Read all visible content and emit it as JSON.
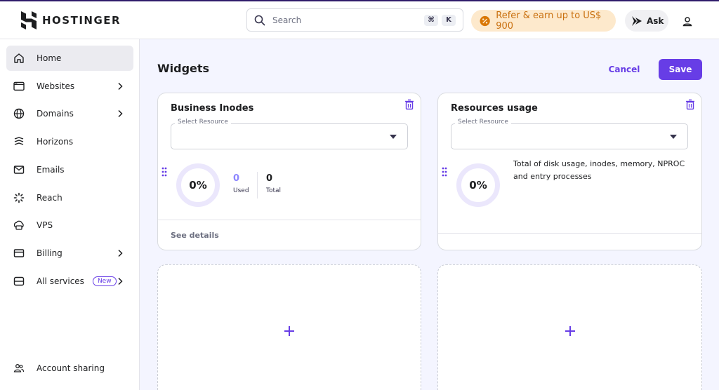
{
  "header": {
    "logo_text": "HOSTINGER",
    "search_placeholder": "Search",
    "search_kbd": [
      "⌘",
      "K"
    ],
    "refer_label": "Refer & earn up to US$ 900",
    "ask_label": "Ask"
  },
  "sidebar": {
    "items": [
      {
        "label": "Home",
        "icon": "home-icon",
        "chevron": false,
        "active": true
      },
      {
        "label": "Websites",
        "icon": "browser-window-icon",
        "chevron": true
      },
      {
        "label": "Domains",
        "icon": "globe-icon",
        "chevron": true
      },
      {
        "label": "Horizons",
        "icon": "horizons-icon",
        "chevron": false
      },
      {
        "label": "Emails",
        "icon": "mail-icon",
        "chevron": false
      },
      {
        "label": "Reach",
        "icon": "reach-icon",
        "chevron": false
      },
      {
        "label": "VPS",
        "icon": "server-icon",
        "chevron": false
      },
      {
        "label": "Billing",
        "icon": "credit-card-icon",
        "chevron": true
      },
      {
        "label": "All services",
        "icon": "services-icon",
        "chevron": true,
        "badge": "New"
      }
    ],
    "footer": {
      "label": "Account sharing",
      "icon": "users-icon"
    }
  },
  "main": {
    "title": "Widgets",
    "cancel_label": "Cancel",
    "save_label": "Save",
    "widgets": [
      {
        "title": "Business Inodes",
        "select_label": "Select Resource",
        "percent": "0%",
        "used_value": "0",
        "used_label": "Used",
        "total_value": "0",
        "total_label": "Total",
        "link": "See details"
      },
      {
        "title": "Resources usage",
        "select_label": "Select Resource",
        "percent": "0%",
        "description": "Total of disk usage, inodes, memory, NPROC and entry processes"
      }
    ],
    "add_symbol": "+"
  },
  "colors": {
    "brand_purple": "#673de6",
    "refer_bg": "#fde9cc",
    "refer_text": "#c9700f",
    "page_bg": "#f4f5ff"
  }
}
